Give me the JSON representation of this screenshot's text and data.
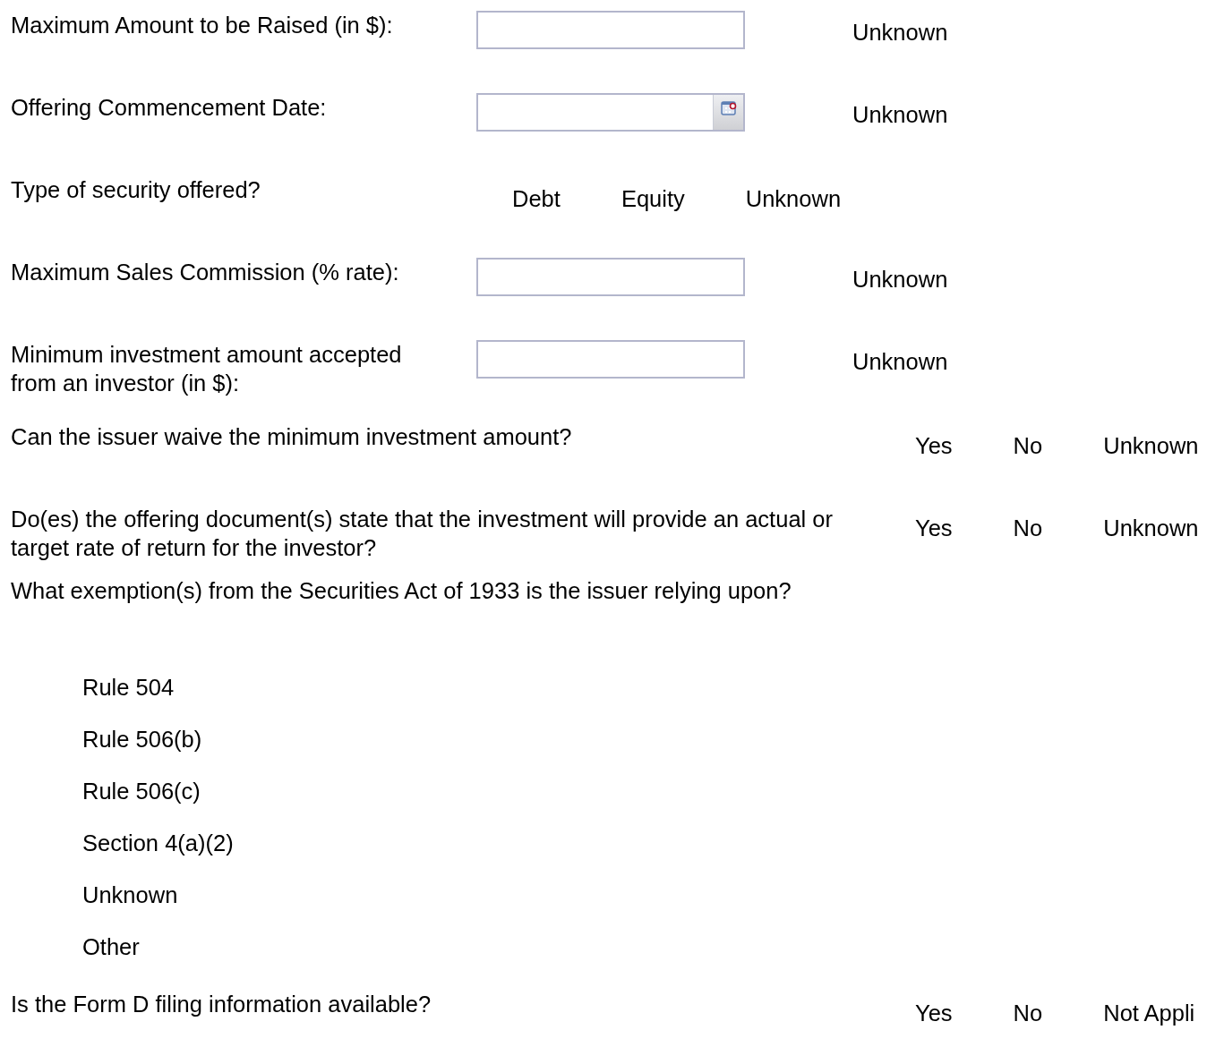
{
  "rows": [
    {
      "kind": "text_field",
      "label": "Maximum Amount to be Raised (in $):",
      "unknown_label": "Unknown"
    },
    {
      "kind": "date_field",
      "label": "Offering Commencement Date:",
      "unknown_label": "Unknown"
    },
    {
      "kind": "inline_choice",
      "label": "Type of security offered?",
      "options": [
        "Debt",
        "Equity",
        "Unknown"
      ]
    },
    {
      "kind": "text_field",
      "label": "Maximum Sales Commission (% rate):",
      "unknown_label": "Unknown"
    },
    {
      "kind": "text_field",
      "label": "Minimum investment amount accepted from an investor (in $):",
      "unknown_label": "Unknown"
    },
    {
      "kind": "choice",
      "label": "Can the issuer waive the minimum investment amount?",
      "options": [
        "Yes",
        "No",
        "Unknown"
      ]
    },
    {
      "kind": "choice",
      "label": "Do(es) the offering document(s) state that the investment will provide an actual or target rate of return for the investor?",
      "options": [
        "Yes",
        "No",
        "Unknown"
      ]
    },
    {
      "kind": "checklist",
      "label": "What exemption(s) from the Securities Act of 1933 is the issuer relying upon?",
      "options": [
        "Rule 504",
        "Rule 506(b)",
        "Rule 506(c)",
        "Section 4(a)(2)",
        "Unknown",
        "Other"
      ]
    },
    {
      "kind": "choice",
      "label": "Is the Form D filing information available?",
      "options": [
        "Yes",
        "No",
        "Not Appli"
      ]
    }
  ]
}
